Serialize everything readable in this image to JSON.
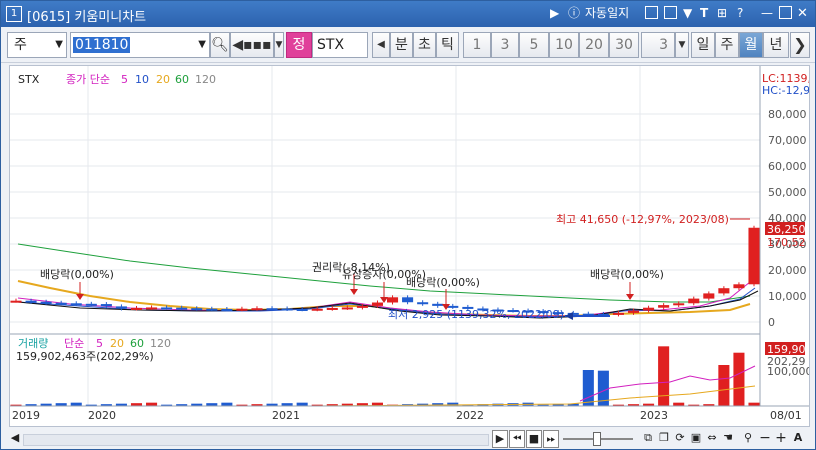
{
  "window": {
    "number": "1",
    "title": "[0615] 키움미니차트",
    "auto_save_label": "자동일지"
  },
  "toolbar": {
    "type_select": "주",
    "code_value": "011810",
    "category_badge": "정",
    "stock_name": "STX",
    "period_buttons": [
      "분",
      "초",
      "틱"
    ],
    "interval_buttons": [
      "1",
      "3",
      "5",
      "10",
      "20",
      "30"
    ],
    "custom_interval": "3",
    "range_buttons": [
      "일",
      "주",
      "월",
      "년"
    ],
    "active_range": "월"
  },
  "price_panel": {
    "legend_name": "STX",
    "legend_ma_label": "종가 단순",
    "ma_periods": [
      "5",
      "10",
      "20",
      "60",
      "120"
    ],
    "ma_colors": [
      "#d21fbf",
      "#2150c8",
      "#e6a81e",
      "#1ea03c",
      "#888888"
    ],
    "top_labels": [
      "LC:1139,",
      "HC:-12,9"
    ],
    "y_ticks": [
      "80,000",
      "70,000",
      "60,000",
      "50,000",
      "40,000",
      "30,000",
      "20,000",
      "10,000",
      "0"
    ],
    "current_price": "36,250",
    "current_change": "170,52",
    "annotations": {
      "dividend1": "배당락(0,00%)",
      "rights": "권리락(-8,14%)",
      "bonus": "유상증자(0,00%)",
      "dividend2": "배당락(0,00%)",
      "dividend3": "배당락(0,00%)",
      "high": "최고 41,650 (-12,97%, 2023/08)",
      "low": "최저 2,925 (1139,32%, 2022/09)"
    }
  },
  "volume_panel": {
    "legend_label": "거래량",
    "legend_ma_label": "단순",
    "ma_periods": [
      "5",
      "20",
      "60",
      "120"
    ],
    "volume_text": "159,902,463주(202,29%)",
    "y_ticks": [
      "100,000"
    ],
    "current_volume": "159,90",
    "current_ratio": "202,29"
  },
  "x_axis": {
    "labels": [
      "2019",
      "2020",
      "2021",
      "2022",
      "2023",
      "08/01"
    ]
  },
  "chart_data": {
    "type": "candlestick",
    "interval": "monthly",
    "period": [
      "2019-08",
      "2023-08"
    ],
    "price_max_label": 41650,
    "price_min_label": 2925,
    "last_close_label": 36250,
    "last_volume": 159902463,
    "monthly_close_approx": [
      8200,
      7800,
      7400,
      7200,
      7000,
      6900,
      6000,
      5200,
      5400,
      5600,
      5500,
      5300,
      5100,
      5000,
      4900,
      5100,
      5300,
      5200,
      5000,
      4900,
      5100,
      5400,
      5600,
      6200,
      7500,
      9500,
      7600,
      7000,
      6200,
      5800,
      5200,
      4800,
      4600,
      4400,
      4200,
      3800,
      3500,
      3200,
      3100,
      2925,
      3500,
      4400,
      5500,
      6500,
      7200,
      9000,
      11000,
      13000,
      14500,
      36250
    ],
    "volume_peaks": [
      {
        "period": "2022-10",
        "approx_volume": 108000000
      },
      {
        "period": "2022-11",
        "approx_volume": 106000000
      },
      {
        "period": "2023-03",
        "approx_volume": 179000000
      },
      {
        "period": "2023-07",
        "approx_volume": 123000000
      },
      {
        "period": "2023-08",
        "approx_volume": 159902463
      }
    ]
  }
}
